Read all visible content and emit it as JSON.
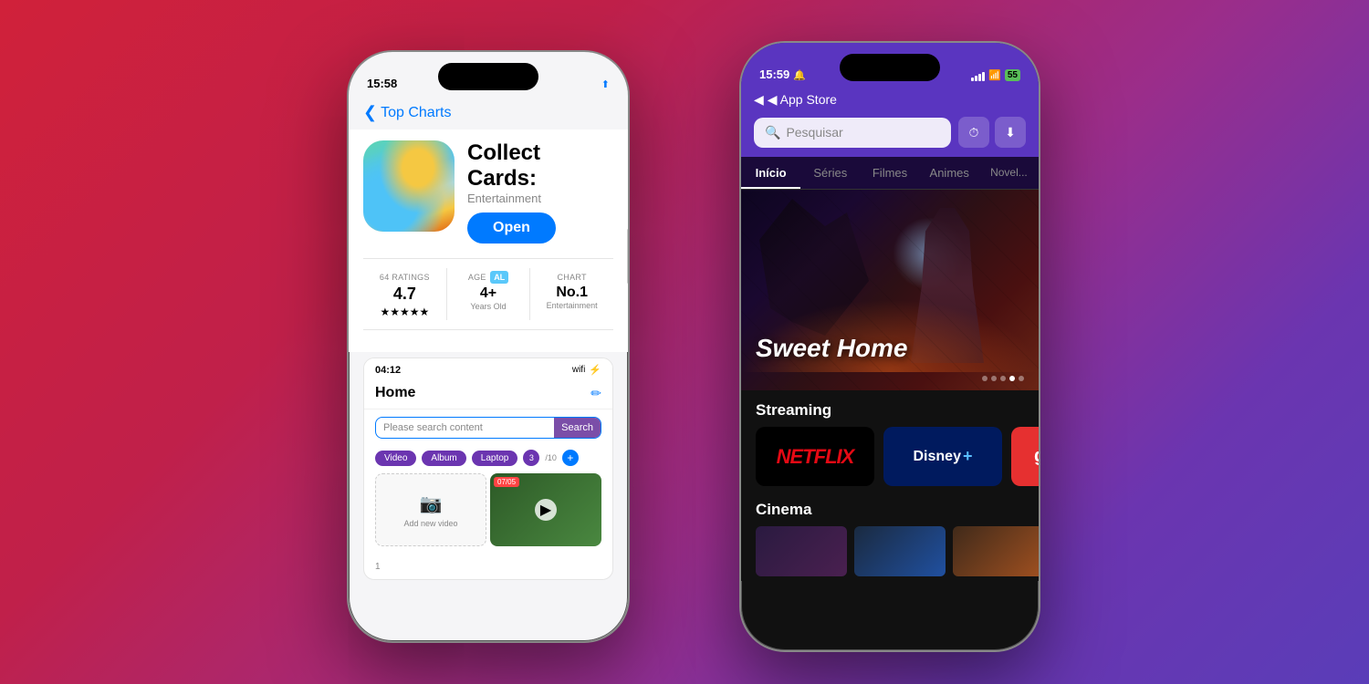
{
  "background": {
    "gradient": "linear-gradient(135deg, #d0213a, #9b2d8a, #5a3db8)"
  },
  "phone_left": {
    "status_bar": {
      "time": "15:58",
      "location_icon": "📍"
    },
    "nav": {
      "back_label": "Top Charts"
    },
    "app": {
      "name": "Collect Cards:",
      "category": "Entertainment",
      "rating_count": "64 RATINGS",
      "rating_value": "4.7",
      "stars": "★★★★★",
      "age_label": "AGE",
      "age_badge": "AL",
      "age_value": "4+",
      "age_sub": "Years Old",
      "chart_label": "CHART",
      "chart_value": "No.1",
      "chart_sub": "Entertainment",
      "open_btn": "Open"
    },
    "preview": {
      "time": "04:12",
      "title": "Home",
      "search_placeholder": "Please search content",
      "search_btn": "Search",
      "tags": [
        "Video",
        "Album",
        "Laptop"
      ],
      "tag_count": "3/10",
      "add_video_label": "Add new video",
      "date_badge": "07/05",
      "cell_number": "1"
    }
  },
  "phone_right": {
    "status_bar": {
      "time": "15:59",
      "bell_icon": "🔔",
      "battery": "55"
    },
    "nav": {
      "back_label": "◀ App Store"
    },
    "search": {
      "placeholder": "Pesquisar"
    },
    "tabs": [
      "Início",
      "Séries",
      "Filmes",
      "Animes",
      "Novel..."
    ],
    "active_tab": "Início",
    "hero": {
      "title": "Sweet Home",
      "dots": 5,
      "active_dot": 3
    },
    "streaming": {
      "section_title": "Streaming",
      "services": [
        "NETFLIX",
        "Disney+",
        "glo"
      ]
    },
    "cinema": {
      "section_title": "Cinema"
    }
  }
}
